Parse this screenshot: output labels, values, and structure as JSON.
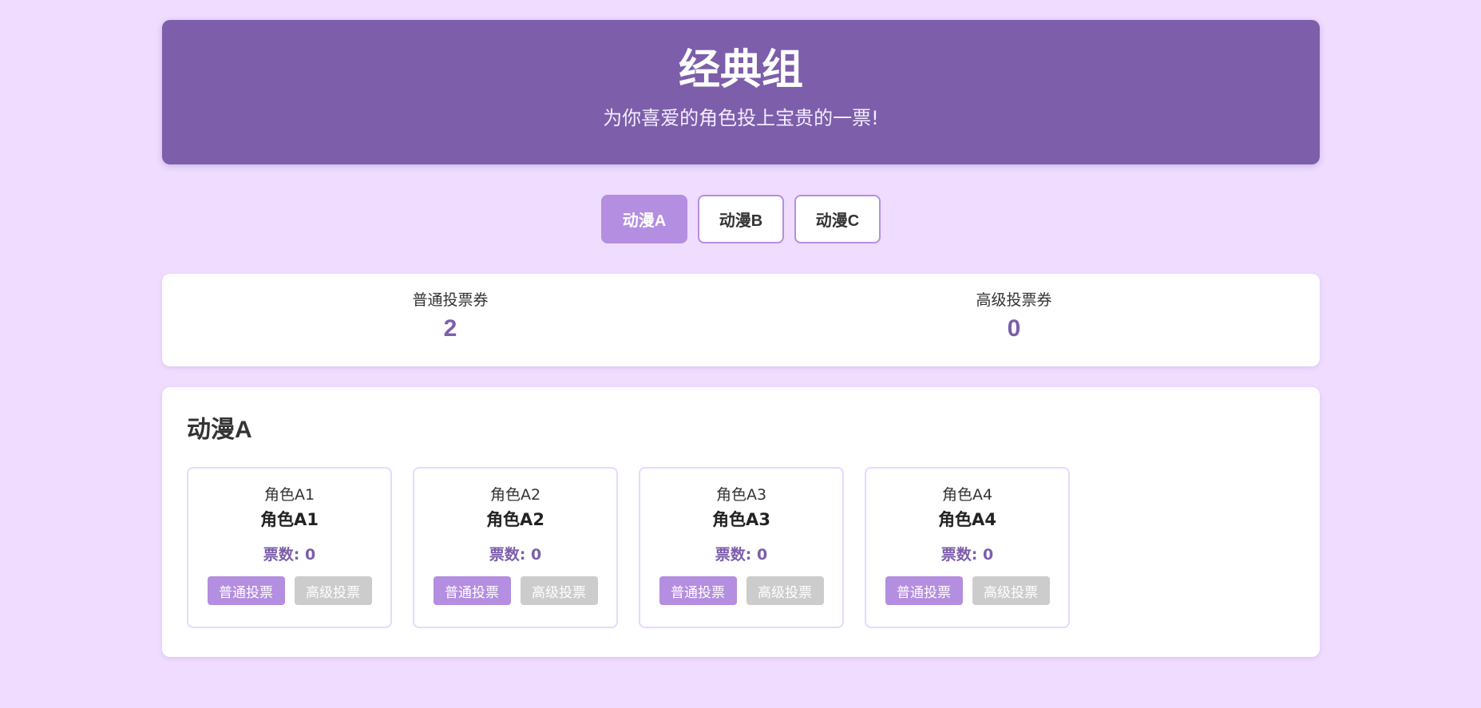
{
  "header": {
    "title": "经典组",
    "subtitle": "为你喜爱的角色投上宝贵的一票!"
  },
  "tabs": [
    {
      "label": "动漫A",
      "active": true
    },
    {
      "label": "动漫B",
      "active": false
    },
    {
      "label": "动漫C",
      "active": false
    }
  ],
  "tickets": {
    "normal_label": "普通投票券",
    "normal_count": "2",
    "premium_label": "高级投票券",
    "premium_count": "0"
  },
  "panel": {
    "title": "动漫A",
    "characters": [
      {
        "image_alt": "角色A1",
        "name": "角色A1",
        "votes": "票数: 0",
        "normal_btn": "普通投票",
        "premium_btn": "高级投票"
      },
      {
        "image_alt": "角色A2",
        "name": "角色A2",
        "votes": "票数: 0",
        "normal_btn": "普通投票",
        "premium_btn": "高级投票"
      },
      {
        "image_alt": "角色A3",
        "name": "角色A3",
        "votes": "票数: 0",
        "normal_btn": "普通投票",
        "premium_btn": "高级投票"
      },
      {
        "image_alt": "角色A4",
        "name": "角色A4",
        "votes": "票数: 0",
        "normal_btn": "普通投票",
        "premium_btn": "高级投票"
      }
    ]
  },
  "colors": {
    "background": "#efdcff",
    "header": "#7c5eaa",
    "accent": "#b48ee0",
    "disabled": "#cccccc"
  }
}
